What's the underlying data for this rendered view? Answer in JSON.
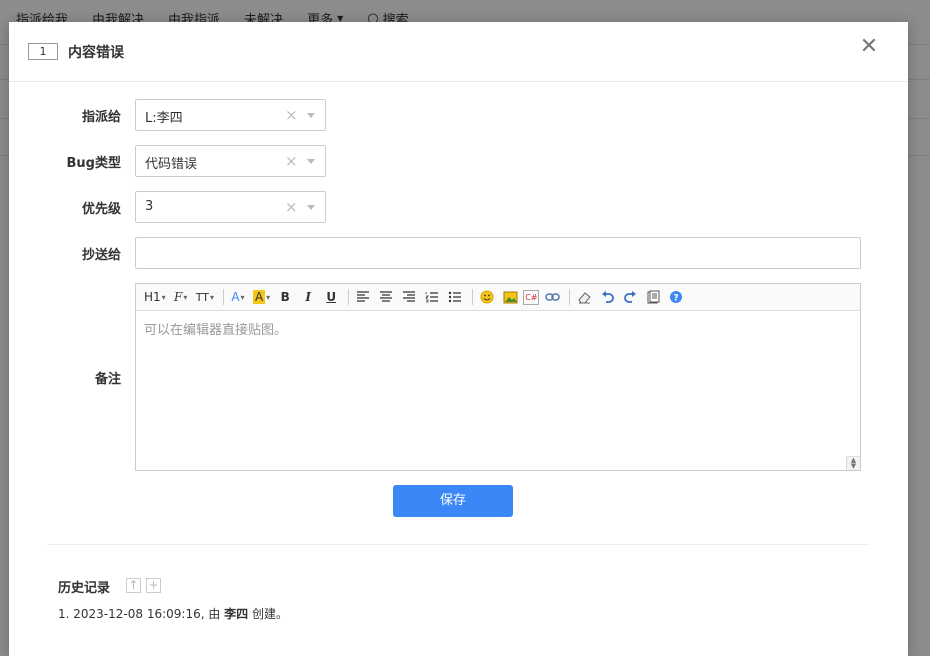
{
  "background_nav": {
    "items": [
      "指派给我",
      "由我解决",
      "由我指派",
      "未解决",
      "更多",
      "搜索"
    ]
  },
  "modal": {
    "id": "1",
    "title": "内容错误",
    "close_symbol": "✕"
  },
  "form": {
    "assignee": {
      "label": "指派给",
      "value": "L:李四"
    },
    "bug_type": {
      "label": "Bug类型",
      "value": "代码错误"
    },
    "priority": {
      "label": "优先级",
      "value": "3"
    },
    "cc": {
      "label": "抄送给",
      "value": ""
    },
    "note": {
      "label": "备注",
      "placeholder": "可以在编辑器直接贴图。"
    },
    "clear_symbol": "×"
  },
  "toolbar": {
    "heading": "H1",
    "font": "F",
    "font_size": "TT",
    "font_color": "A",
    "bg_color": "A",
    "bold": "B",
    "italic": "I",
    "underline": "U",
    "code": "C#"
  },
  "actions": {
    "save_label": "保存"
  },
  "history": {
    "title": "历史记录",
    "entries": [
      {
        "prefix": "1. 2023-12-08 16:09:16, 由 ",
        "user": "李四",
        "suffix": " 创建。"
      }
    ]
  },
  "colors": {
    "primary": "#3a87f5",
    "highlight": "#f5c518"
  }
}
